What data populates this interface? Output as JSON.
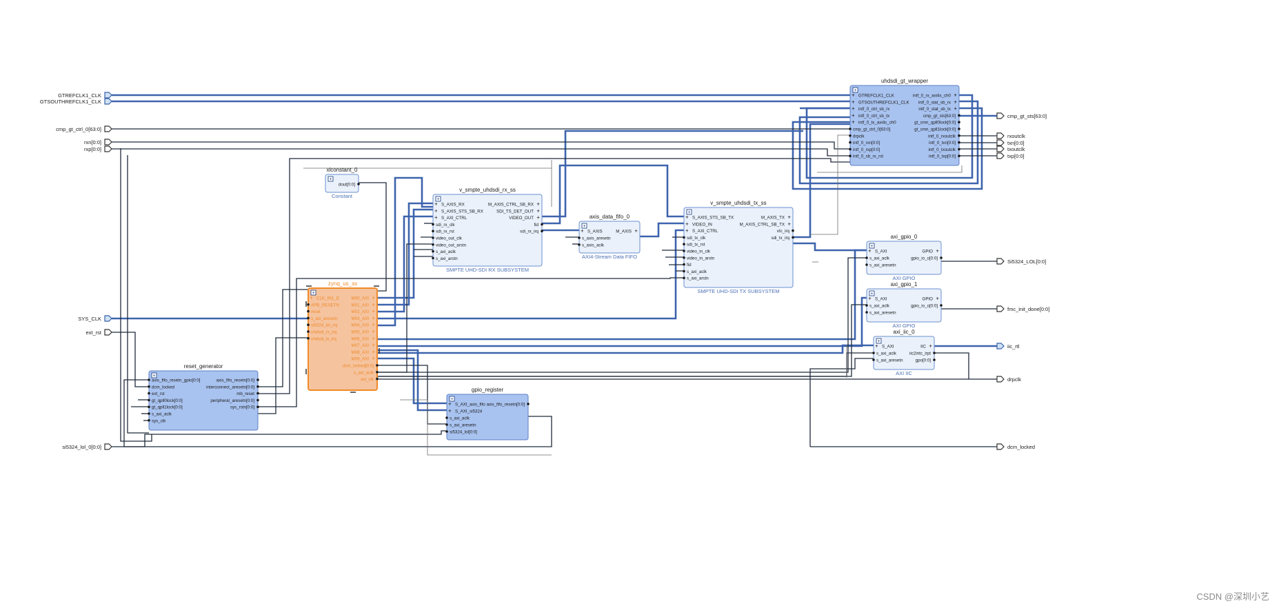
{
  "ports_left": [
    {
      "id": "gtrefclk1",
      "label": "GTREFCLK1_CLK",
      "kind": "clk"
    },
    {
      "id": "gtsouthrefclk1",
      "label": "GTSOUTHREFCLK1_CLK",
      "kind": "clk"
    },
    {
      "id": "cmp_gt_ctrl",
      "label": "cmp_gt_ctrl_0[63:0]",
      "kind": "in"
    },
    {
      "id": "rxn",
      "label": "rxn[0:0]",
      "kind": "in"
    },
    {
      "id": "rxp",
      "label": "rxp[0:0]",
      "kind": "in"
    },
    {
      "id": "sys_clk",
      "label": "SYS_CLK",
      "kind": "clk"
    },
    {
      "id": "ext_rst",
      "label": "ext_rst",
      "kind": "in"
    },
    {
      "id": "si5324_lol",
      "label": "si5324_lol_0[0:0]",
      "kind": "in"
    }
  ],
  "ports_right": [
    {
      "id": "cmp_gt_sts",
      "label": "cmp_gt_sts[63:0]",
      "kind": "out"
    },
    {
      "id": "rxoutclk",
      "label": "rxoutclk",
      "kind": "out"
    },
    {
      "id": "txn",
      "label": "txn[0:0]",
      "kind": "out"
    },
    {
      "id": "txoutclk",
      "label": "txoutclk",
      "kind": "out"
    },
    {
      "id": "txp",
      "label": "txp[0:0]",
      "kind": "out"
    },
    {
      "id": "si5324_lol_out",
      "label": "Si5324_LOL[0:0]",
      "kind": "out"
    },
    {
      "id": "fmc_init_done",
      "label": "fmc_init_done[0:0]",
      "kind": "out"
    },
    {
      "id": "iic_rtl",
      "label": "iic_rtl",
      "kind": "bus"
    },
    {
      "id": "drpclk",
      "label": "drpclk",
      "kind": "out"
    },
    {
      "id": "dcm_locked",
      "label": "dcm_locked",
      "kind": "out"
    }
  ],
  "blocks": [
    {
      "id": "uhdsdi_gt_wrapper",
      "title": "uhdsdi_gt_wrapper",
      "subtitle": "",
      "style": "blue",
      "left": [
        "GTREFCLK1_CLK",
        "GTSOUTHREFCLK1_CLK",
        "intf_0_ctrl_sb_rx",
        "intf_0_ctrl_sb_tx",
        "intf_0_tx_axi4s_ch0",
        "cmp_gt_ctrl_0[63:0]",
        "drpclk",
        "intf_0_rxn[0:0]",
        "intf_0_rxp[0:0]",
        "intf_0_sb_rx_rst"
      ],
      "right": [
        "intf_0_rx_axi4s_ch0",
        "intf_0_stat_sb_rx",
        "intf_0_stat_sb_tx",
        "cmp_gt_sts[63:0]",
        "gt_cmn_qpll0lock[0:0]",
        "gt_cmn_qpll1lock[0:0]",
        "intf_0_rxoutclk",
        "intf_0_txn[0:0]",
        "intf_0_txoutclk",
        "intf_0_txp[0:0]"
      ]
    },
    {
      "id": "xlconstant_0",
      "title": "xlconstant_0",
      "subtitle": "Constant",
      "style": "light",
      "left": [],
      "right": [
        "dout[0:0]"
      ]
    },
    {
      "id": "v_smpte_uhdsdi_rx_ss",
      "title": "v_smpte_uhdsdi_rx_ss",
      "subtitle": "SMPTE UHD-SDI RX SUBSYSTEM",
      "style": "light",
      "left": [
        "S_AXIS_RX",
        "S_AXIS_STS_SB_RX",
        "S_AXI_CTRL",
        "sdi_rx_clk",
        "sdi_rx_rst",
        "video_out_clk",
        "video_out_arstn",
        "s_axi_aclk",
        "s_axi_arstn"
      ],
      "right": [
        "M_AXIS_CTRL_SB_RX",
        "SDI_TS_DET_OUT",
        "VIDEO_OUT",
        "fid",
        "sdi_rx_irq"
      ]
    },
    {
      "id": "axis_data_fifo_0",
      "title": "axis_data_fifo_0",
      "subtitle": "AXI4-Stream Data FIFO",
      "style": "light",
      "left": [
        "S_AXIS",
        "s_axis_aresetn",
        "s_axis_aclk"
      ],
      "right": [
        "M_AXIS"
      ]
    },
    {
      "id": "v_smpte_uhdsdi_tx_ss",
      "title": "v_smpte_uhdsdi_tx_ss",
      "subtitle": "SMPTE UHD-SDI TX SUBSYSTEM",
      "style": "light",
      "left": [
        "S_AXIS_STS_SB_TX",
        "VIDEO_IN",
        "S_AXI_CTRL",
        "sdi_tx_clk",
        "sdi_tx_rst",
        "video_in_clk",
        "video_in_arstn",
        "fid",
        "s_axi_aclk",
        "s_axi_arstn"
      ],
      "right": [
        "M_AXIS_TX",
        "M_AXIS_CTRL_SB_TX",
        "vtc_irq",
        "sdi_tx_irq"
      ]
    },
    {
      "id": "axi_gpio_0",
      "title": "axi_gpio_0",
      "subtitle": "AXI GPIO",
      "style": "light",
      "left": [
        "S_AXI",
        "s_axi_aclk",
        "s_axi_aresetn"
      ],
      "right": [
        "GPIO",
        "gpio_io_o[0:0]"
      ]
    },
    {
      "id": "axi_gpio_1",
      "title": "axi_gpio_1",
      "subtitle": "AXI GPIO",
      "style": "light",
      "left": [
        "S_AXI",
        "s_axi_aclk",
        "s_axi_aresetn"
      ],
      "right": [
        "GPIO",
        "gpio_io_o[0:0]"
      ]
    },
    {
      "id": "axi_iic_0",
      "title": "axi_iic_0",
      "subtitle": "AXI IIC",
      "style": "light",
      "left": [
        "S_AXI",
        "s_axi_aclk",
        "s_axi_aresetn"
      ],
      "right": [
        "IIC",
        "iic2intc_irpt",
        "gpo[0:0]"
      ]
    },
    {
      "id": "zynq_us_ss",
      "title": "zynq_us_ss",
      "subtitle": "",
      "style": "orange",
      "left": [
        "CLK_IN1_D",
        "APB_RESETN",
        "reset",
        "s_axi_aresetn",
        "si5324_lol_irq",
        "uhdsdi_rx_irq",
        "uhdsdi_tx_irq"
      ],
      "right": [
        "M00_AXI",
        "M01_AXI",
        "M02_AXI",
        "M03_AXI",
        "M04_AXI",
        "M05_AXI",
        "M06_AXI",
        "M07_AXI",
        "M08_AXI",
        "M09_AXI",
        "dcm_locked[0:0]",
        "s_axi_aclk",
        "axi_clk"
      ]
    },
    {
      "id": "reset_generator",
      "title": "reset_generator",
      "subtitle": "",
      "style": "blue",
      "left": [
        "axis_fifo_resetn_gpio[0:0]",
        "dcm_locked",
        "ext_rst",
        "gt_qpll0lock[0:0]",
        "gt_qpll1lock[0:0]",
        "s_axi_aclk",
        "sys_clk"
      ],
      "right": [
        "axis_fifo_resetn[0:0]",
        "interconnect_aresetn[0:0]",
        "mb_reset",
        "peripheral_aresetn[0:0]",
        "sys_rstn[0:0]"
      ]
    },
    {
      "id": "gpio_register",
      "title": "gpio_register",
      "subtitle": "",
      "style": "blue",
      "left": [
        "S_AXI_axis_fifo",
        "S_AXI_si5324",
        "s_axi_aclk",
        "s_axi_aresetn",
        "si5324_lol[0:0]"
      ],
      "right": [
        "axis_fifo_resetn[0:0]"
      ]
    }
  ],
  "watermark": "CSDN @深圳小艺"
}
